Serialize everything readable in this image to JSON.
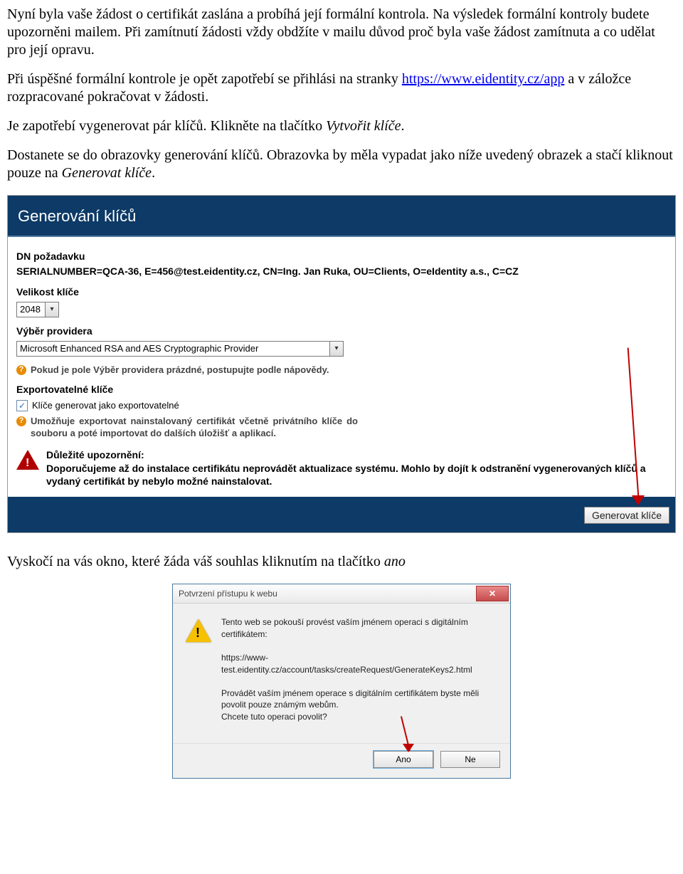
{
  "paragraphs": {
    "p1": "Nyní byla vaše žádost o certifikát zaslána a probíhá její formální kontrola. Na výsledek formální kontroly budete upozorněni mailem. Při zamítnutí žádosti vždy obdžíte v mailu důvod proč byla vaše žádost zamítnuta a co udělat pro její opravu.",
    "p2a": "Při úspěšné formální kontrole je opět zapotřebí se přihlási na stranky  ",
    "p2_link_text": "https://www.eidentity.cz/app",
    "p2b": " a v záložce rozpracované pokračovat v žádosti.",
    "p3a": "Je zapotřebí vygenerovat pár klíčů. Klikněte na tlačítko ",
    "p3_i": "Vytvořit klíče",
    "p3b": ".",
    "p4a": "Dostanete se do obrazovky generování klíčů. Obrazovka by měla vypadat jako níže uvedený obrazek a stačí kliknout pouze na ",
    "p4_i": "Generovat klíče",
    "p4b": ".",
    "p5a": "Vyskočí na vás okno, které žáda váš souhlas kliknutím na tlačítko ",
    "p5_i": "ano"
  },
  "keygen": {
    "title": "Generování klíčů",
    "dn_label": "DN požadavku",
    "dn_value": "SERIALNUMBER=QCA-36, E=456@test.eidentity.cz, CN=Ing. Jan Ruka, OU=Clients, O=eIdentity a.s., C=CZ",
    "keysize_label": "Velikost klíče",
    "keysize_value": "2048",
    "provider_label": "Výběr providera",
    "provider_value": "Microsoft Enhanced RSA and AES Cryptographic Provider",
    "provider_hint": "Pokud je pole Výběr providera prázdné, postupujte podle nápovědy.",
    "export_label": "Exportovatelné klíče",
    "export_chk_label": "Klíče generovat jako exportovatelné",
    "export_hint": "Umožňuje exportovat nainstalovaný certifikát včetně privátního klíče do souboru a poté importovat do dalších úložišť a aplikací.",
    "warn_title": "Důležité upozornění:",
    "warn_body": "Doporučujeme až do instalace certifikátu neprovádět aktualizace systému. Mohlo by dojít k odstranění vygenerovaných klíčů a vydaný certifikát by nebylo možné nainstalovat.",
    "button": "Generovat klíče"
  },
  "dialog": {
    "title": "Potvrzení přístupu k webu",
    "line1": "Tento web se pokouší provést vaším jménem operaci s digitálním certifikátem:",
    "url": "https://www-test.eidentity.cz/account/tasks/createRequest/GenerateKeys2.html",
    "line2": "Provádět vaším jménem operace s digitálním certifikátem byste měli povolit pouze známým webům.",
    "line3": "Chcete tuto operaci povolit?",
    "yes": "Ano",
    "no": "Ne"
  }
}
